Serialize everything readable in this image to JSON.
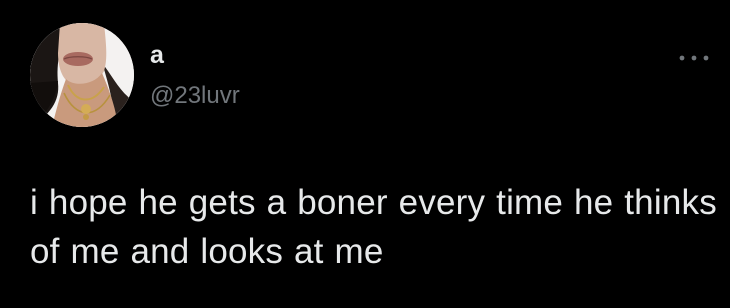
{
  "tweet": {
    "author": {
      "display_name": "a",
      "handle": "@23luvr",
      "avatar_icon": "profile-photo"
    },
    "more_icon": "more-horizontal-icon",
    "text": "i hope he gets a boner every time he thinks of me and looks at me"
  },
  "colors": {
    "background": "#000000",
    "primary_text": "#e7e9ea",
    "secondary_text": "#71767b"
  }
}
